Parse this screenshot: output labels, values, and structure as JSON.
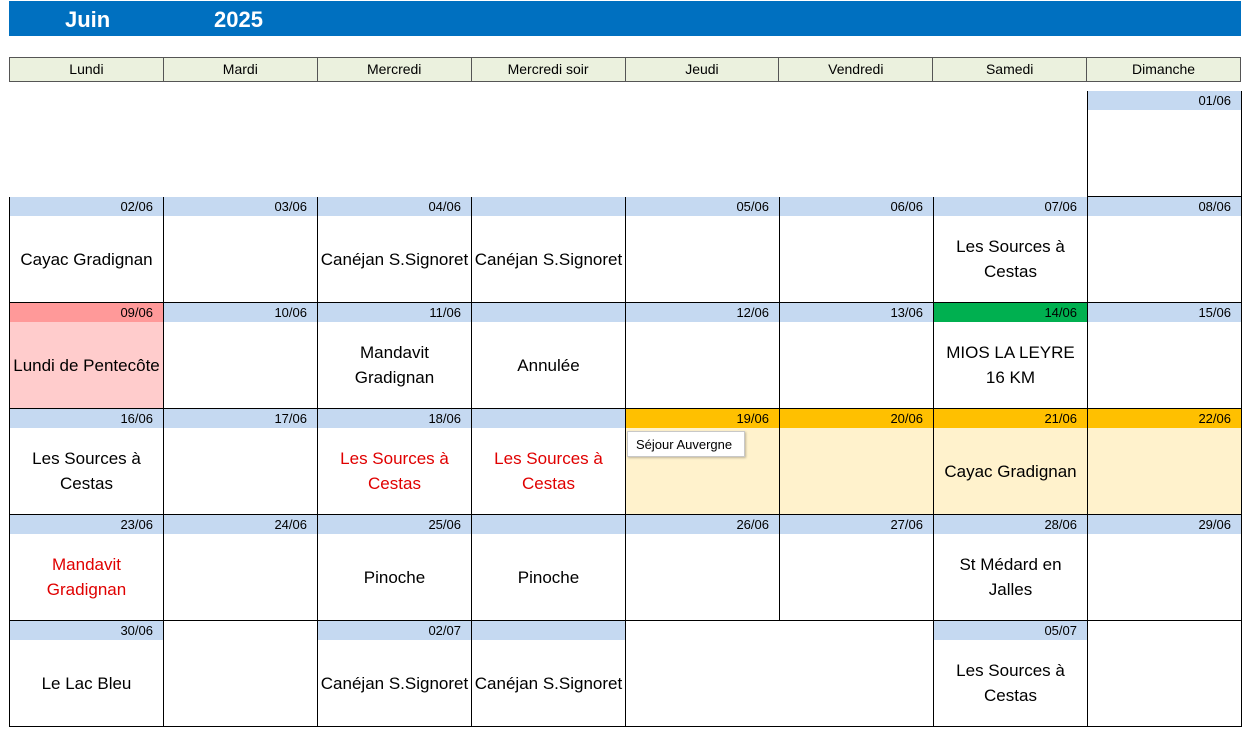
{
  "header": {
    "month": "Juin",
    "year": "2025"
  },
  "days": [
    "Lundi",
    "Mardi",
    "Mercredi",
    "Mercredi soir",
    "Jeudi",
    "Vendredi",
    "Samedi",
    "Dimanche"
  ],
  "colors": {
    "header_blue": "#0070c0",
    "day_header_bg": "#ebf1de",
    "date_strip": "#c5d9f1",
    "holiday_strip": "#ff9999",
    "holiday_bg": "#ffcccc",
    "green_strip": "#00b050",
    "orange_strip": "#ffc000",
    "orange_bg": "#fff2cc",
    "red_text": "#e00000"
  },
  "tooltip": "Séjour Auvergne",
  "weeks": [
    [
      {},
      {},
      {},
      {},
      {},
      {},
      {},
      {
        "date": "01/06"
      }
    ],
    [
      {
        "date": "02/06",
        "event": "Cayac Gradignan"
      },
      {
        "date": "03/06"
      },
      {
        "date": "04/06",
        "event": "Canéjan S.Signoret"
      },
      {
        "date": "",
        "event": "Canéjan S.Signoret"
      },
      {
        "date": "05/06"
      },
      {
        "date": "06/06"
      },
      {
        "date": "07/06",
        "event": "Les Sources à Cestas"
      },
      {
        "date": "08/06"
      }
    ],
    [
      {
        "date": "09/06",
        "event": "Lundi de Pentecôte",
        "strip": "#ff9999",
        "bg": "#ffcccc"
      },
      {
        "date": "10/06"
      },
      {
        "date": "11/06",
        "event": "Mandavit Gradignan"
      },
      {
        "date": "",
        "event": "Annulée"
      },
      {
        "date": "12/06"
      },
      {
        "date": "13/06"
      },
      {
        "date": "14/06",
        "event": "MIOS LA LEYRE 16 KM",
        "strip": "#00b050"
      },
      {
        "date": "15/06"
      }
    ],
    [
      {
        "date": "16/06",
        "event": "Les Sources à Cestas"
      },
      {
        "date": "17/06"
      },
      {
        "date": "18/06",
        "event": "Les Sources à Cestas",
        "red": true
      },
      {
        "date": "",
        "event": "Les Sources à Cestas",
        "red": true
      },
      {
        "date": "19/06",
        "strip": "#ffc000",
        "bg": "#fff2cc"
      },
      {
        "date": "20/06",
        "strip": "#ffc000",
        "bg": "#fff2cc"
      },
      {
        "date": "21/06",
        "event": "Cayac Gradignan",
        "strip": "#ffc000",
        "bg": "#fff2cc"
      },
      {
        "date": "22/06",
        "strip": "#ffc000",
        "bg": "#fff2cc"
      }
    ],
    [
      {
        "date": "23/06",
        "event": "Mandavit Gradignan",
        "red": true
      },
      {
        "date": "24/06"
      },
      {
        "date": "25/06",
        "event": "Pinoche"
      },
      {
        "date": "",
        "event": "Pinoche"
      },
      {
        "date": "26/06"
      },
      {
        "date": "27/06"
      },
      {
        "date": "28/06",
        "event": "St Médard en Jalles"
      },
      {
        "date": "29/06"
      }
    ],
    [
      {
        "date": "30/06",
        "event": "Le Lac Bleu"
      },
      {
        "nostrip": true
      },
      {
        "date": "02/07",
        "event": "Canéjan S.Signoret"
      },
      {
        "date": "",
        "event": "Canéjan S.Signoret"
      },
      {
        "nostrip": true,
        "noleft": true,
        "noright": true
      },
      {
        "nostrip": true,
        "noleft": true
      },
      {
        "date": "05/07",
        "event": "Les Sources à Cestas"
      },
      {
        "nostrip": true
      }
    ]
  ]
}
